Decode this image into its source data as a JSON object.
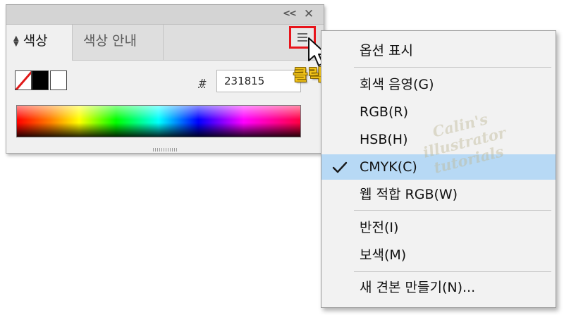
{
  "panel": {
    "collapse_icon": "double-chevron-left-icon",
    "close_icon": "close-icon",
    "tabs": [
      {
        "label": "색상",
        "active": true,
        "icon": "sort-arrows-icon"
      },
      {
        "label": "색상 안내",
        "active": false
      }
    ],
    "menu_icon": "hamburger-menu-icon",
    "hash_label": "#",
    "hex_value": "231815",
    "swatch_icons": [
      "none-swatch-icon",
      "black-swatch-icon",
      "white-swatch-icon"
    ]
  },
  "annotation": {
    "click_label": "클릭",
    "highlight_color": "#e8141b",
    "label_color": "#f2c318"
  },
  "menu": {
    "items": [
      {
        "label": "옵션 표시"
      },
      {
        "label": "회색 음영(G)"
      },
      {
        "label": "RGB(R)"
      },
      {
        "label": "HSB(H)"
      },
      {
        "label": "CMYK(C)",
        "checked": true
      },
      {
        "label": "웹 적합 RGB(W)"
      },
      {
        "label": "반전(I)"
      },
      {
        "label": "보색(M)"
      },
      {
        "label": "새 견본 만들기(N)..."
      }
    ],
    "check_icon": "checkmark-icon",
    "highlight_color": "#b7d9f5"
  },
  "watermark": {
    "lines": [
      "Calin's",
      "illustrator",
      "tutorials"
    ]
  }
}
